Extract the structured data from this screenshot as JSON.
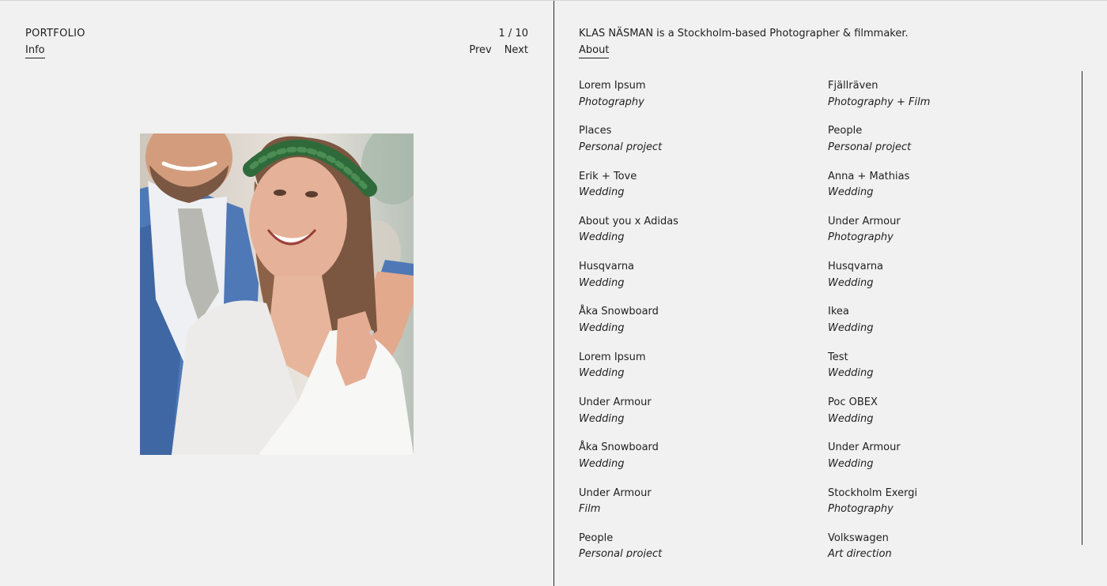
{
  "header": {
    "brand": "PORTFOLIO",
    "info_link": "Info",
    "counter": "1 / 10",
    "prev_label": "Prev",
    "next_label": "Next"
  },
  "bio": {
    "text": "KLAS NÄSMAN is a Stockholm-based Photographer & filmmaker.",
    "about_link": "About"
  },
  "projects": [
    {
      "title": "Lorem Ipsum",
      "category": "Photography"
    },
    {
      "title": "Fjällräven",
      "category": "Photography + Film"
    },
    {
      "title": "Places",
      "category": "Personal project"
    },
    {
      "title": "People",
      "category": "Personal project"
    },
    {
      "title": "Erik + Tove",
      "category": "Wedding"
    },
    {
      "title": "Anna + Mathias",
      "category": "Wedding"
    },
    {
      "title": "About you x Adidas",
      "category": "Wedding"
    },
    {
      "title": "Under Armour",
      "category": "Photography"
    },
    {
      "title": "Husqvarna",
      "category": "Wedding"
    },
    {
      "title": "Husqvarna",
      "category": "Wedding"
    },
    {
      "title": "Åka Snowboard",
      "category": "Wedding"
    },
    {
      "title": "Ikea",
      "category": "Wedding"
    },
    {
      "title": "Lorem Ipsum",
      "category": "Wedding"
    },
    {
      "title": "Test",
      "category": "Wedding"
    },
    {
      "title": "Under Armour",
      "category": "Wedding"
    },
    {
      "title": "Poc OBEX",
      "category": "Wedding"
    },
    {
      "title": "Åka Snowboard",
      "category": "Wedding"
    },
    {
      "title": "Under Armour",
      "category": "Wedding"
    },
    {
      "title": "Under Armour",
      "category": "Film"
    },
    {
      "title": "Stockholm Exergi",
      "category": "Photography"
    },
    {
      "title": "People",
      "category": "Personal project"
    },
    {
      "title": "Volkswagen",
      "category": "Art direction"
    }
  ]
}
